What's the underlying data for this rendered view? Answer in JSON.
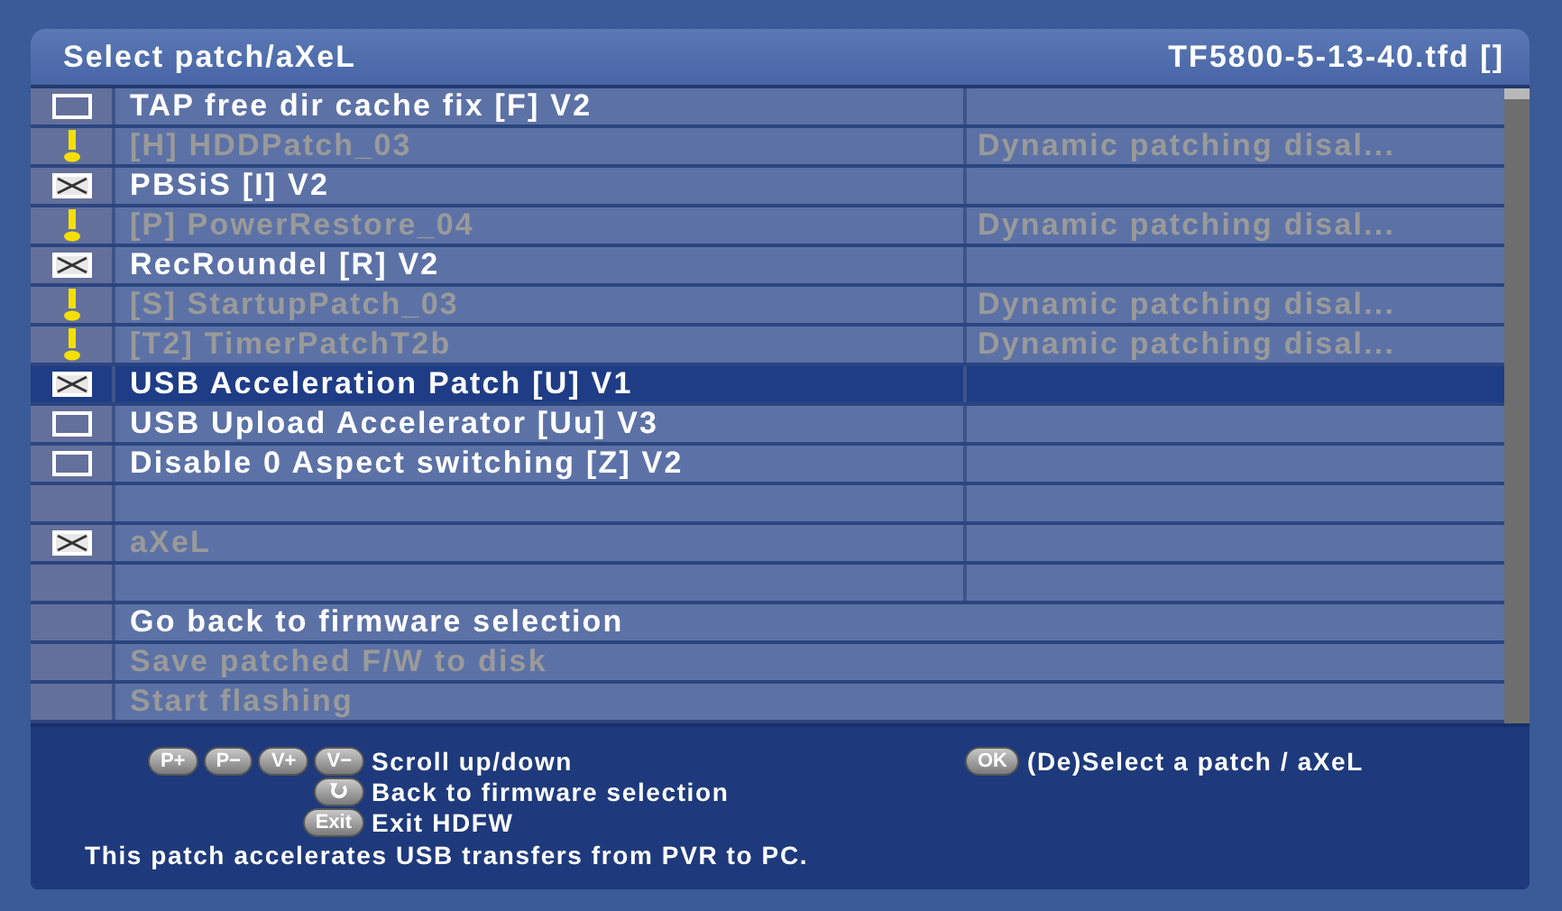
{
  "window": {
    "title": "Select patch/aXeL",
    "file": "TF5800-5-13-40.tfd []"
  },
  "rows": [
    {
      "kind": "checkbox",
      "checked": false,
      "label": "TAP free dir cache fix [F] V2",
      "disabled": false,
      "selected": false
    },
    {
      "kind": "warning",
      "label": "[H] HDDPatch_03",
      "disabled": true,
      "selected": false,
      "note": "Dynamic patching disal..."
    },
    {
      "kind": "checkbox",
      "checked": true,
      "label": "PBSiS [I] V2",
      "disabled": false,
      "selected": false
    },
    {
      "kind": "warning",
      "label": "[P] PowerRestore_04",
      "disabled": true,
      "selected": false,
      "note": "Dynamic patching disal..."
    },
    {
      "kind": "checkbox",
      "checked": true,
      "label": "RecRoundel [R] V2",
      "disabled": false,
      "selected": false
    },
    {
      "kind": "warning",
      "label": "[S] StartupPatch_03",
      "disabled": true,
      "selected": false,
      "note": "Dynamic patching disal..."
    },
    {
      "kind": "warning",
      "label": "[T2] TimerPatchT2b",
      "disabled": true,
      "selected": false,
      "note": "Dynamic patching disal..."
    },
    {
      "kind": "checkbox",
      "checked": true,
      "label": "USB Acceleration Patch [U] V1",
      "disabled": false,
      "selected": true
    },
    {
      "kind": "checkbox",
      "checked": false,
      "label": "USB Upload Accelerator [Uu] V3",
      "disabled": false,
      "selected": false
    },
    {
      "kind": "checkbox",
      "checked": false,
      "label": "Disable 0 Aspect switching [Z] V2",
      "disabled": false,
      "selected": false
    },
    {
      "kind": "separator",
      "selected": false
    },
    {
      "kind": "checkbox",
      "checked": true,
      "label": "aXeL",
      "disabled": true,
      "selected": false
    },
    {
      "kind": "separator",
      "selected": false
    },
    {
      "kind": "action",
      "label": "Go back to firmware selection",
      "disabled": false,
      "selected": false
    },
    {
      "kind": "action",
      "label": "Save patched F/W to disk",
      "disabled": true,
      "selected": false
    },
    {
      "kind": "action",
      "label": "Start flashing",
      "disabled": true,
      "selected": false
    }
  ],
  "help": [
    [
      {
        "keys": [
          {
            "kind": "label",
            "label": "P+"
          },
          {
            "kind": "label",
            "label": "P−"
          },
          {
            "kind": "label",
            "label": "V+"
          },
          {
            "kind": "label",
            "label": "V−"
          }
        ],
        "text": "Scroll up/down"
      },
      {
        "keys": [
          {
            "kind": "label",
            "label": "OK"
          }
        ],
        "text": "(De)Select a patch / aXeL"
      }
    ],
    [
      {
        "keys": [
          {
            "kind": "return"
          }
        ],
        "text": "Back to firmware selection"
      }
    ],
    [
      {
        "keys": [
          {
            "kind": "label",
            "label": "Exit"
          }
        ],
        "text": "Exit HDFW"
      }
    ]
  ],
  "description": "This patch accelerates USB transfers from PVR to PC."
}
